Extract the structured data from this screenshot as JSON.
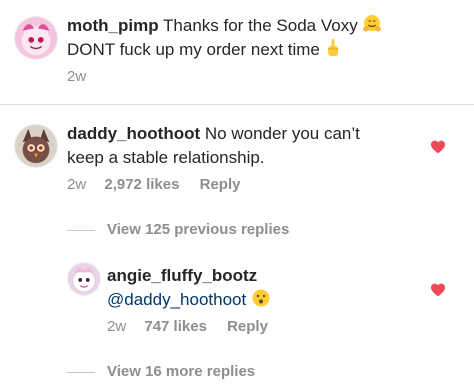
{
  "comments": [
    {
      "username": "moth_pimp",
      "line1": "Thanks for the Soda Voxy",
      "line2": "DONT fuck up my order next time",
      "time": "2w"
    },
    {
      "username": "daddy_hoothoot",
      "line1": "No wonder you can’t",
      "line2": "keep a stable relationship.",
      "time": "2w",
      "likes": "2,972 likes",
      "reply": "Reply",
      "liked": true
    }
  ],
  "view_previous": "View 125 previous replies",
  "reply_comment": {
    "username": "angie_fluffy_bootz",
    "mention": "@daddy_hoothoot",
    "time": "2w",
    "likes": "747 likes",
    "reply": "Reply",
    "liked": true
  },
  "view_more": "View 16 more replies",
  "colors": {
    "heart": "#ed4956",
    "meta": "#8e8e8e",
    "text": "#262626"
  }
}
